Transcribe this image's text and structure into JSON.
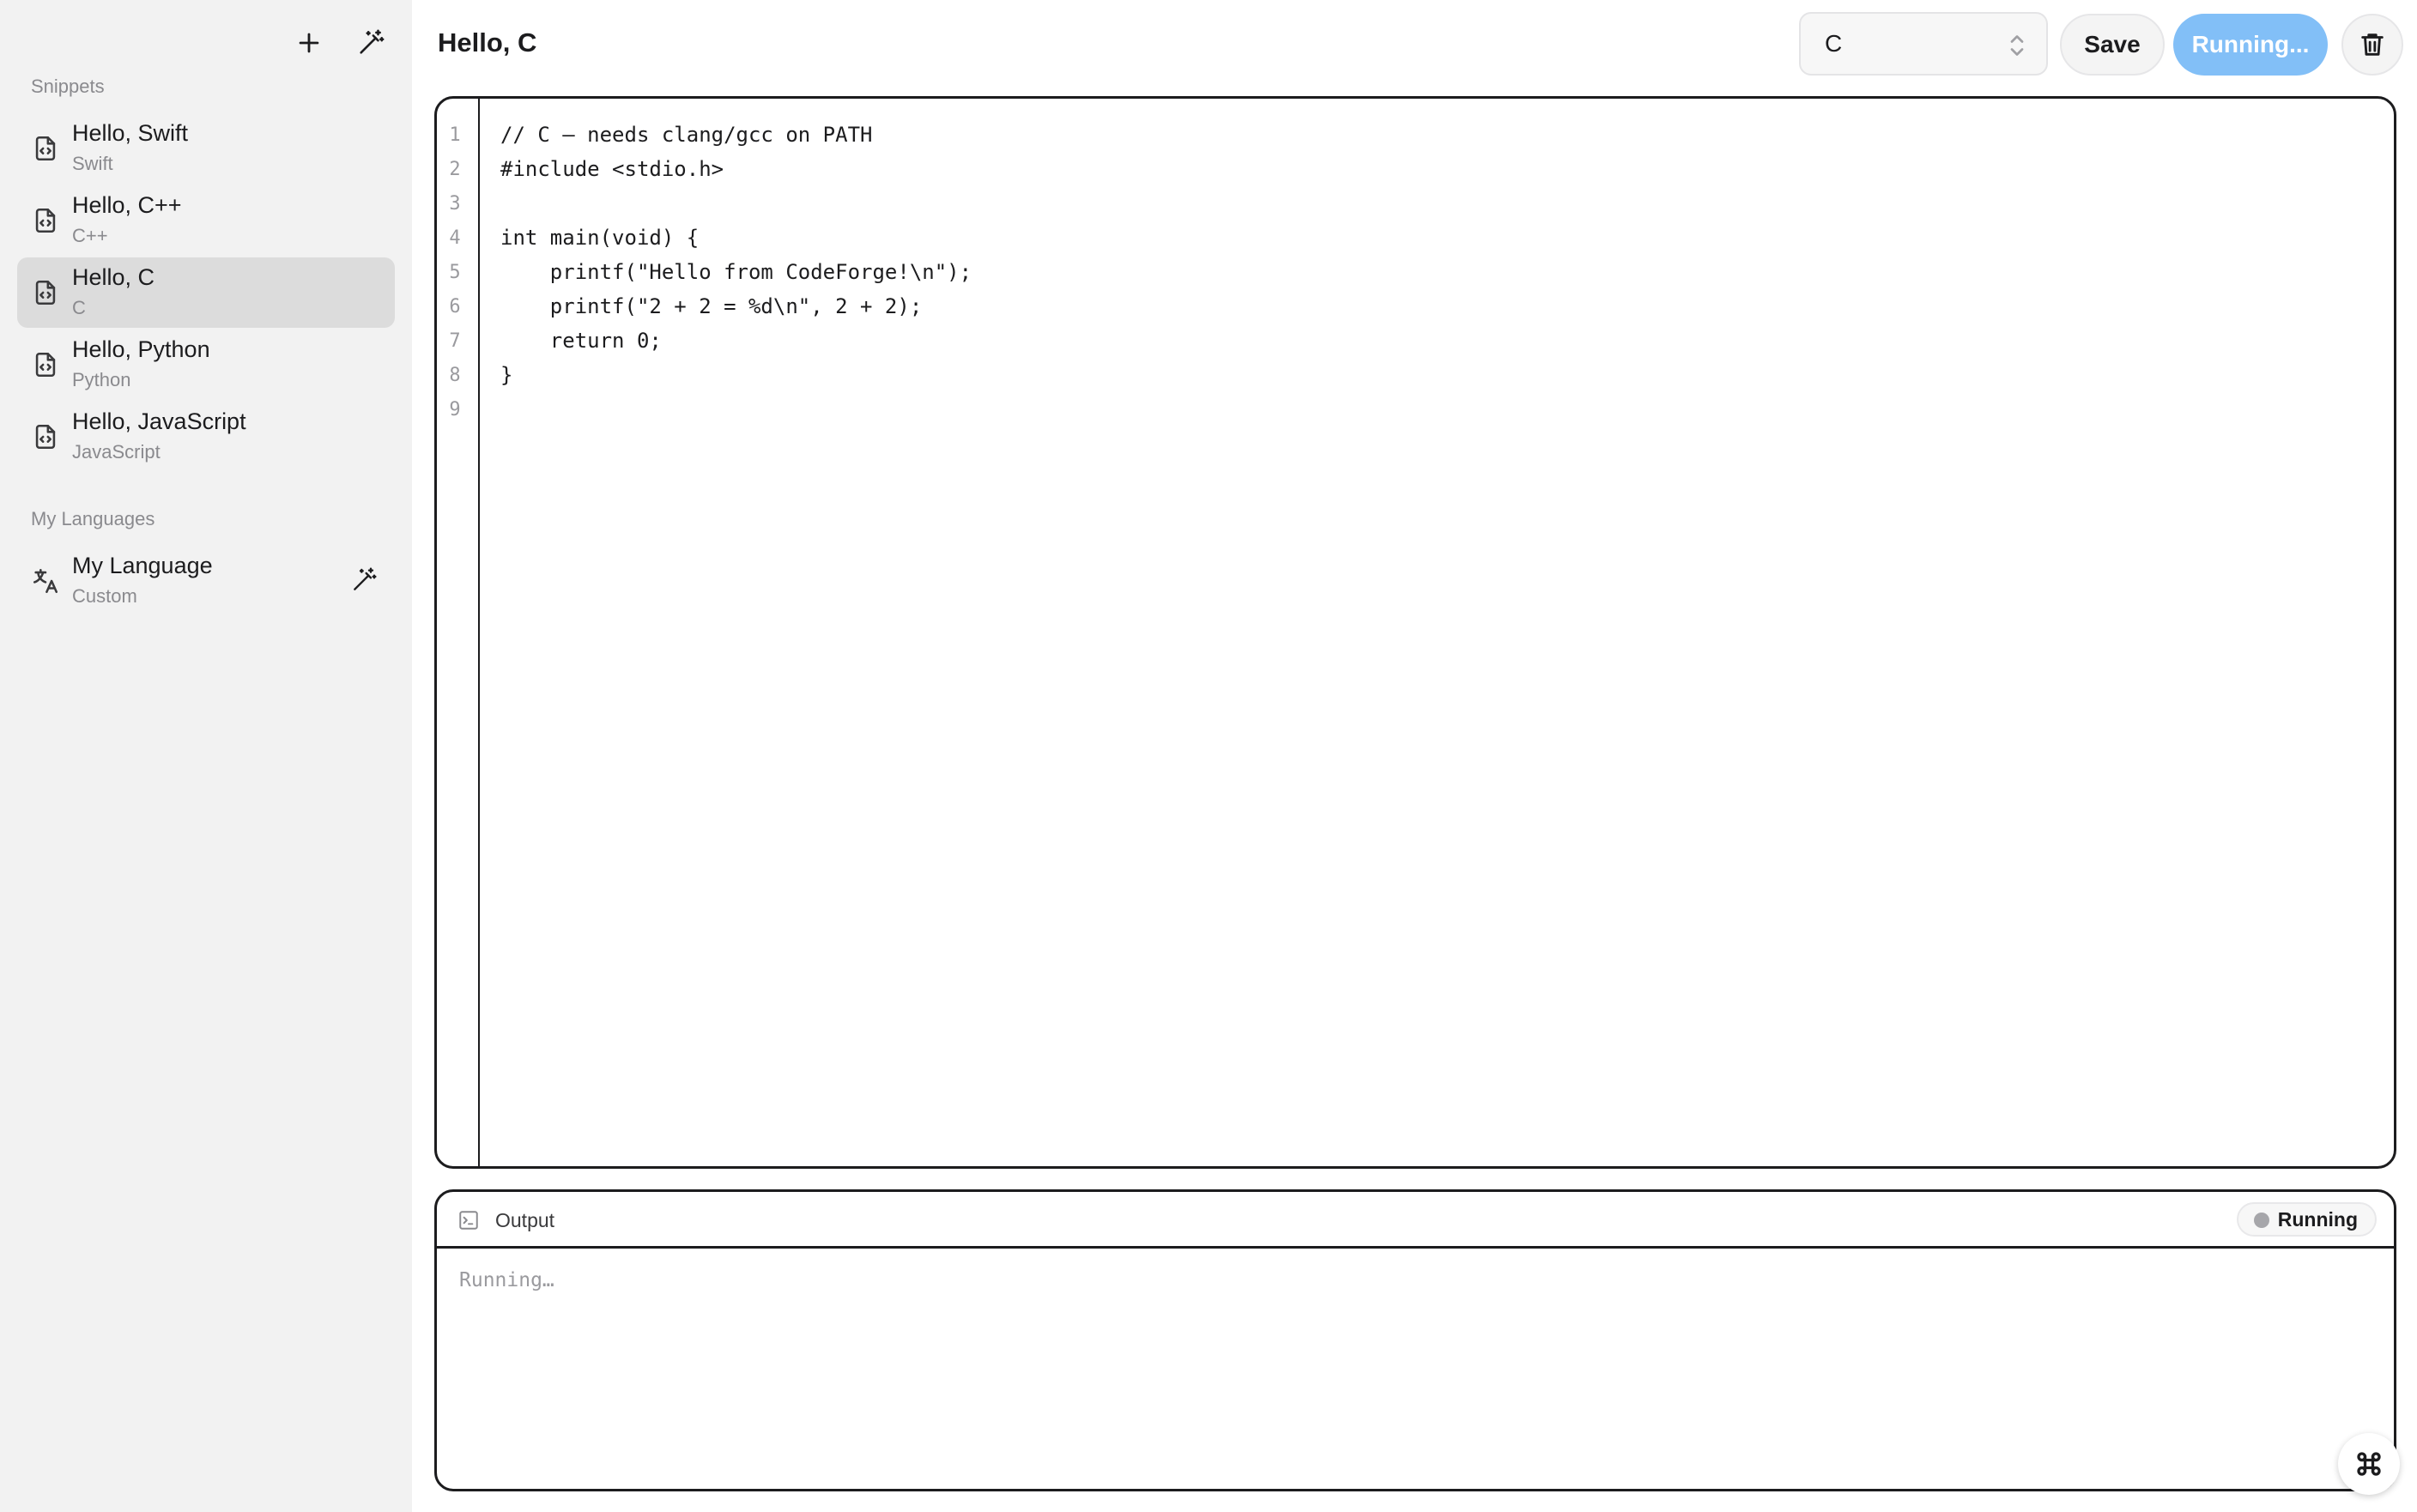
{
  "sidebar": {
    "snippets_label": "Snippets",
    "snippets": [
      {
        "title": "Hello, Swift",
        "language": "Swift",
        "selected": false
      },
      {
        "title": "Hello, C++",
        "language": "C++",
        "selected": false
      },
      {
        "title": "Hello, C",
        "language": "C",
        "selected": true
      },
      {
        "title": "Hello, Python",
        "language": "Python",
        "selected": false
      },
      {
        "title": "Hello, JavaScript",
        "language": "JavaScript",
        "selected": false
      }
    ],
    "languages_label": "My Languages",
    "languages": [
      {
        "title": "My Language",
        "subtitle": "Custom"
      }
    ],
    "icons": {
      "add": "plus-icon",
      "magic": "magic-wand-icon",
      "snippet": "code-file-icon",
      "language": "translate-icon"
    }
  },
  "header": {
    "title": "Hello, C",
    "language_select_value": "C",
    "save_label": "Save",
    "run_label": "Running...",
    "run_color": "#82bff7"
  },
  "editor": {
    "line_numbers": [
      "1",
      "2",
      "3",
      "4",
      "5",
      "6",
      "7",
      "8",
      "9"
    ],
    "lines": [
      "// C — needs clang/gcc on PATH",
      "#include <stdio.h>",
      "",
      "int main(void) {",
      "    printf(\"Hello from CodeForge!\\n\");",
      "    printf(\"2 + 2 = %d\\n\", 2 + 2);",
      "    return 0;",
      "}",
      ""
    ]
  },
  "output": {
    "label": "Output",
    "status": "Running",
    "text": "Running…"
  }
}
